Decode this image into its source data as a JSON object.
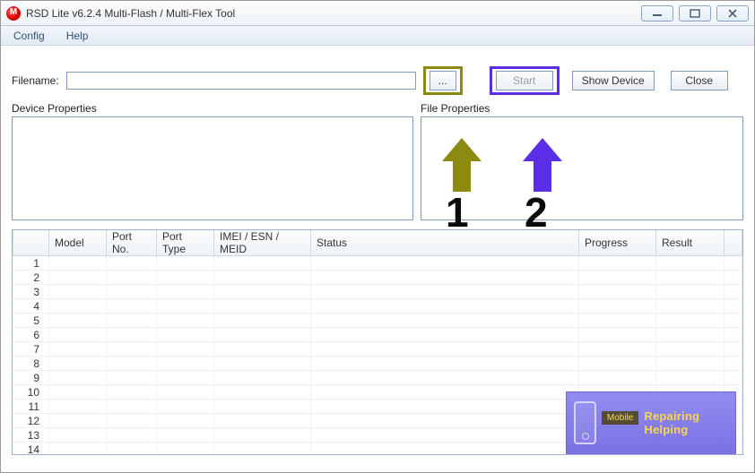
{
  "window": {
    "title": "RSD Lite v6.2.4 Multi-Flash / Multi-Flex Tool",
    "icon_letter": "M"
  },
  "menu": {
    "config": "Config",
    "help": "Help"
  },
  "filename": {
    "label": "Filename:",
    "value": "",
    "browse_label": "..."
  },
  "buttons": {
    "start": "Start",
    "show_device": "Show Device",
    "close": "Close"
  },
  "panels": {
    "device": "Device Properties",
    "file": "File Properties"
  },
  "table": {
    "headers": {
      "model": "Model",
      "port_no": "Port No.",
      "port_type": "Port Type",
      "imei": "IMEI / ESN / MEID",
      "status": "Status",
      "progress": "Progress",
      "result": "Result"
    },
    "rows": [
      "1",
      "2",
      "3",
      "4",
      "5",
      "6",
      "7",
      "8",
      "9",
      "10",
      "11",
      "12",
      "13",
      "14"
    ]
  },
  "annotations": {
    "num1": "1",
    "num2": "2"
  },
  "watermark": {
    "mobile": "Mobile",
    "brand": "Repairing Helping"
  }
}
